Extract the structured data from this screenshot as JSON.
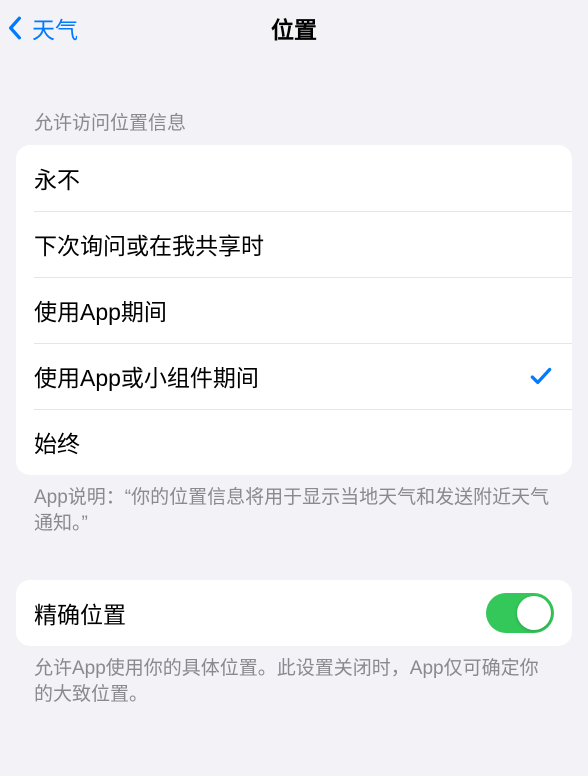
{
  "nav": {
    "back_label": "天气",
    "title": "位置"
  },
  "section1": {
    "header": "允许访问位置信息",
    "options": {
      "0": "永不",
      "1": "下次询问或在我共享时",
      "2": "使用App期间",
      "3": "使用App或小组件期间",
      "4": "始终"
    },
    "selected_index": 3,
    "footer": "App说明：“你的位置信息将用于显示当地天气和发送附近天气通知。”"
  },
  "section2": {
    "precise_label": "精确位置",
    "precise_on": true,
    "footer": "允许App使用你的具体位置。此设置关闭时，App仅可确定你的大致位置。"
  }
}
